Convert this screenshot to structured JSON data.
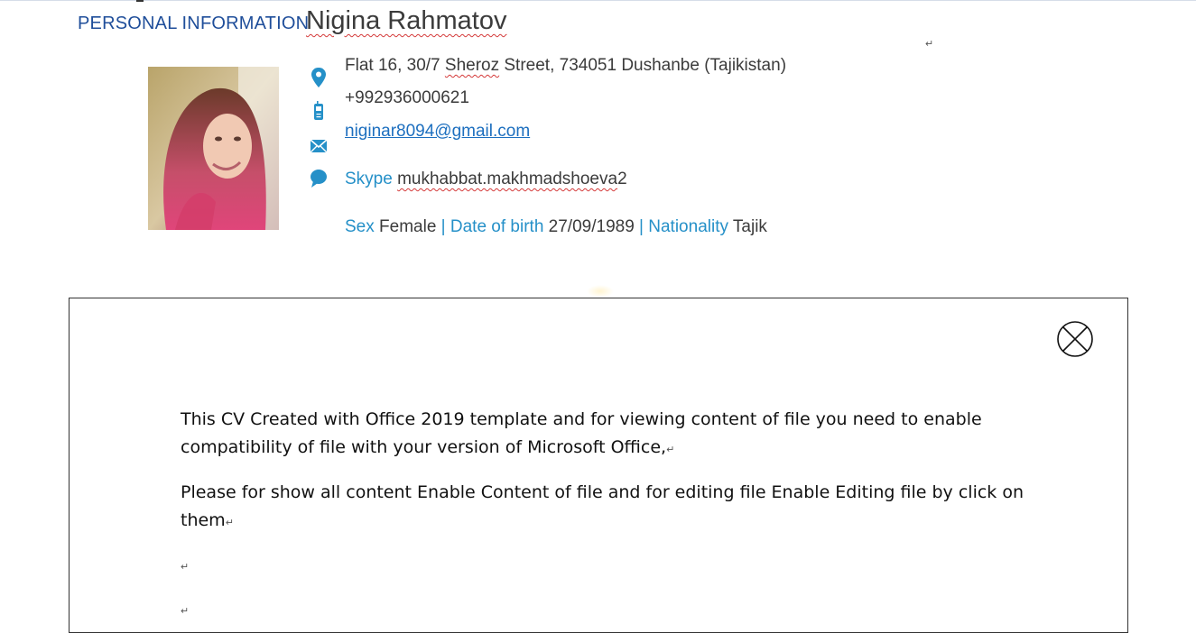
{
  "header": {
    "section_label": "PERSONAL INFORMATION",
    "name": "Nigina Rahmatov"
  },
  "contact": {
    "address_pre": "Flat 16, 30/7 ",
    "address_street": "Sheroz",
    "address_post": " Street, 734051 Dushanbe (Tajikistan)",
    "phone": "+992936000621",
    "email": "niginar8094@gmail.com",
    "skype_label": "Skype",
    "skype_id": "mukhabbat.makhmadshoeva",
    "skype_suffix": "2"
  },
  "details": {
    "sex_label": "Sex",
    "sex_value": "Female",
    "separator": "|",
    "dob_label": "Date of birth",
    "dob_value": "27/09/1989",
    "nationality_label": "Nationality",
    "nationality_value": "Tajik"
  },
  "icons": {
    "location": "location-pin-icon",
    "phone": "mobile-phone-icon",
    "email": "envelope-icon",
    "skype": "chat-bubble-icon",
    "close": "close-circle-icon"
  },
  "colors": {
    "label_blue": "#2590c8",
    "heading_blue": "#1f4e9a",
    "link_blue": "#1d6fbf",
    "spell_underline": "#d43a3a"
  },
  "overlay": {
    "paragraph1": "This CV Created with Office 2019 template and for viewing content of file you need to enable compatibility of file with your version of Microsoft Office,",
    "paragraph2": "Please for show all content Enable Content of file and for editing file Enable Editing file by click on them"
  },
  "marks": {
    "paragraph": "↵"
  }
}
